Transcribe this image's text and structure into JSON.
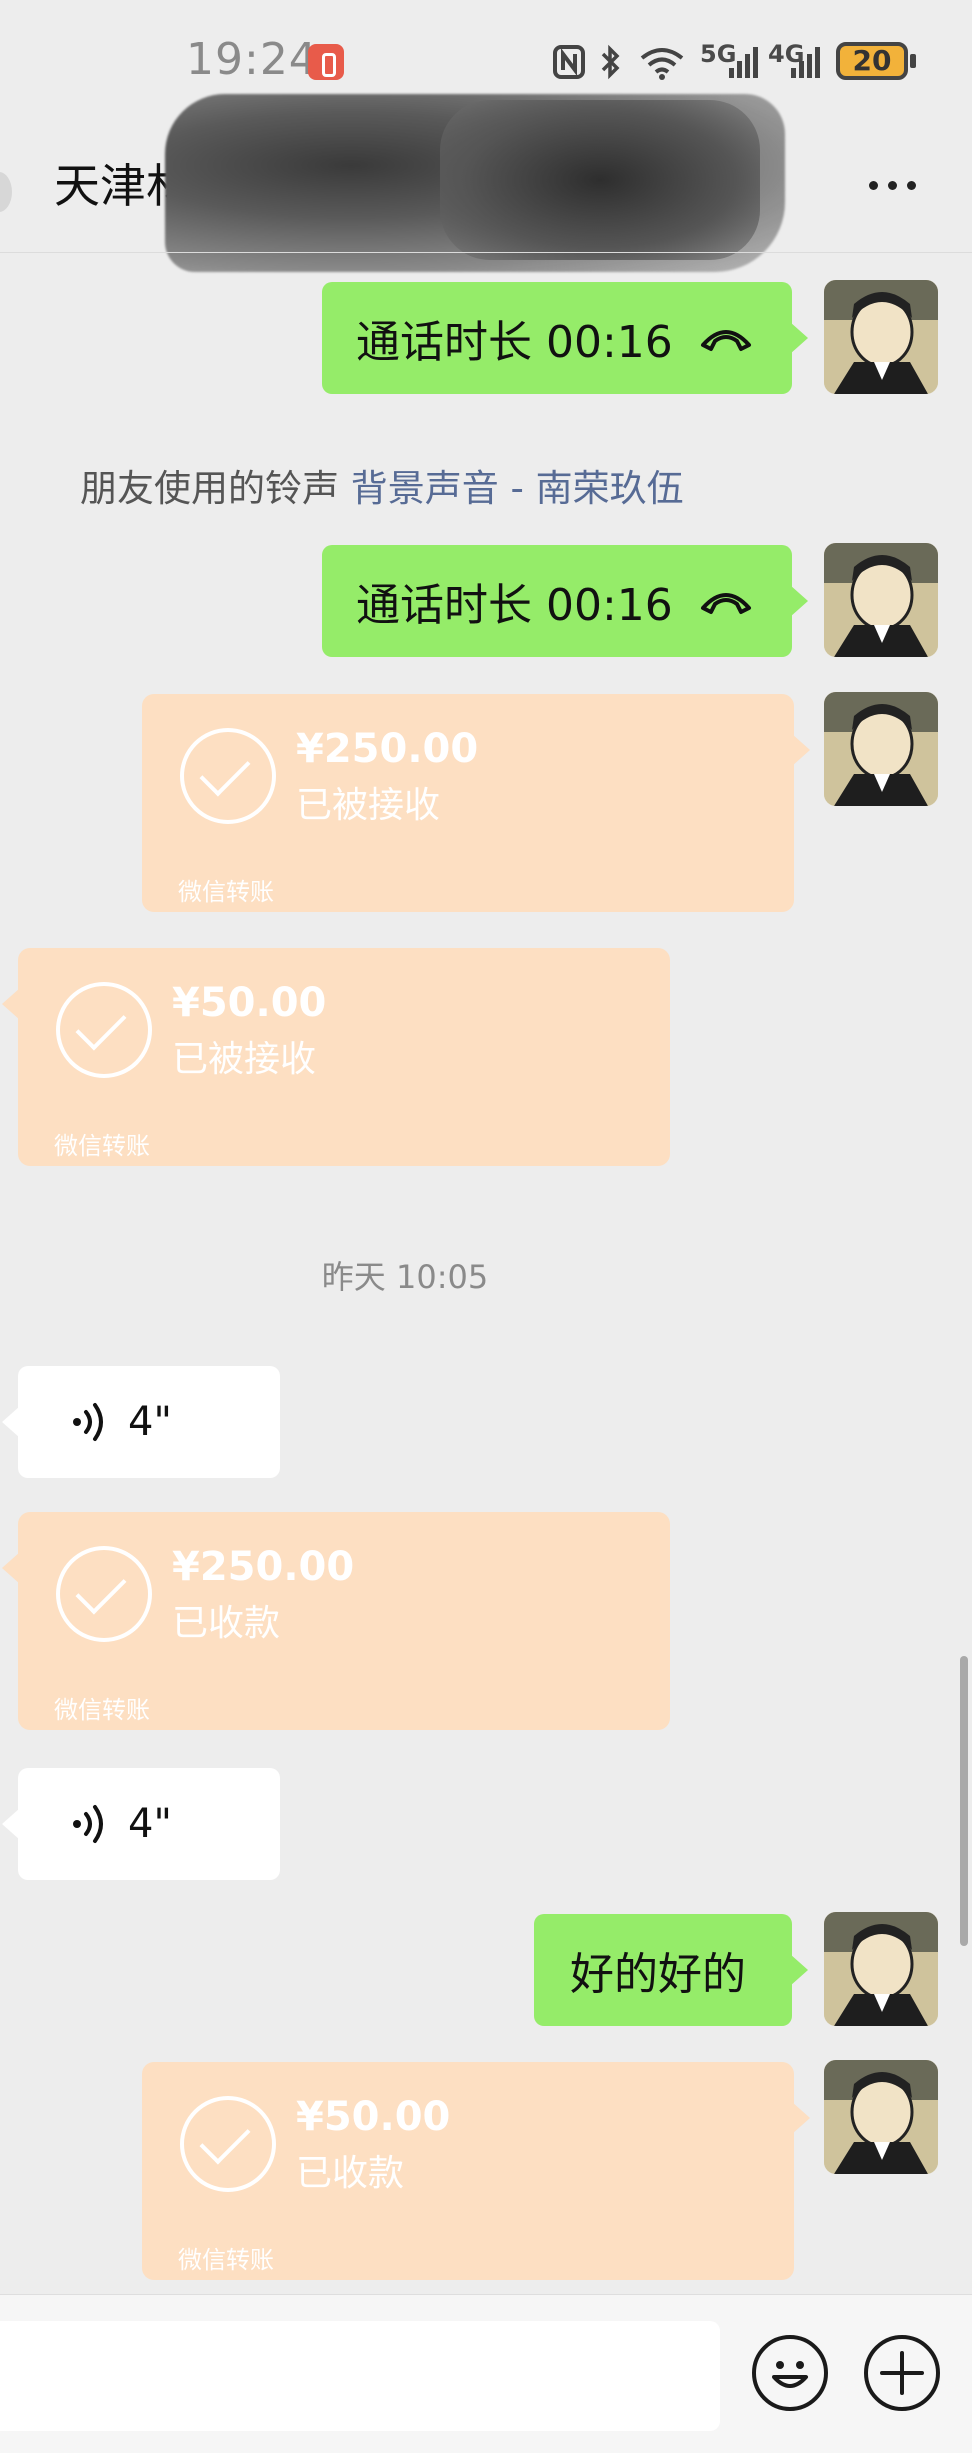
{
  "status_bar": {
    "time": "19:24",
    "network_5g": "5G",
    "network_4g": "4G",
    "battery": "20"
  },
  "header": {
    "title": "天津林"
  },
  "messages": {
    "call_1": {
      "label": "通话时长 00:16"
    },
    "system_ringtone": {
      "prefix": "朋友使用的铃声",
      "ringtone": "背景声音 - 南荣玖伍"
    },
    "call_2": {
      "label": "通话时长 00:16"
    },
    "transfer_1": {
      "amount": "¥250.00",
      "status": "已被接收",
      "footer": "微信转账"
    },
    "transfer_2": {
      "amount": "¥50.00",
      "status": "已被接收",
      "footer": "微信转账"
    },
    "time_separator": "昨天 10:05",
    "voice_1": {
      "duration": "4\""
    },
    "transfer_3": {
      "amount": "¥250.00",
      "status": "已收款",
      "footer": "微信转账"
    },
    "voice_2": {
      "duration": "4\""
    },
    "text_1": {
      "text": "好的好的"
    },
    "transfer_4": {
      "amount": "¥50.00",
      "status": "已收款",
      "footer": "微信转账"
    }
  },
  "input_bar": {
    "emoji_icon": "emoji-icon",
    "plus_icon": "plus-icon"
  },
  "colors": {
    "bubble_green": "#95ec69",
    "transfer_bg": "#fddfc2",
    "link_blue": "#576b95"
  }
}
